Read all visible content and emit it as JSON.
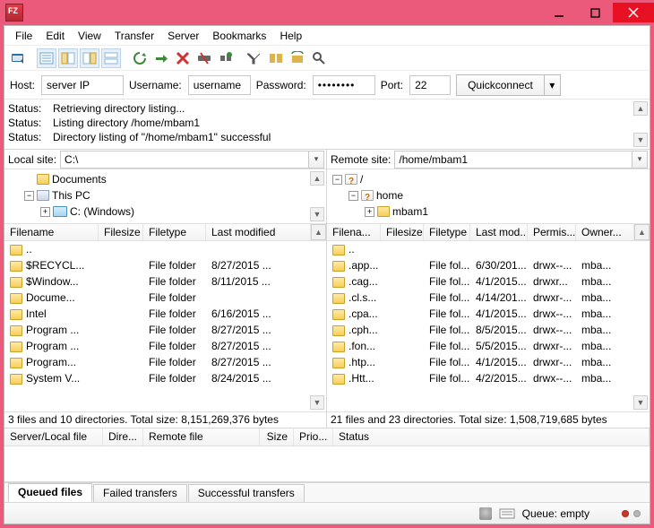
{
  "menubar": [
    "File",
    "Edit",
    "View",
    "Transfer",
    "Server",
    "Bookmarks",
    "Help"
  ],
  "connect": {
    "host_label": "Host:",
    "host_value": "server IP",
    "user_label": "Username:",
    "user_value": "username",
    "pass_label": "Password:",
    "pass_value": "••••••••",
    "port_label": "Port:",
    "port_value": "22",
    "quickconnect": "Quickconnect"
  },
  "log": {
    "status_label": "Status:",
    "lines": [
      "Retrieving directory listing...",
      "Listing directory /home/mbam1",
      "Directory listing of \"/home/mbam1\" successful"
    ]
  },
  "local": {
    "site_label": "Local site:",
    "site_value": "C:\\",
    "tree": {
      "documents": "Documents",
      "thispc": "This PC",
      "cdrive": "C: (Windows)"
    },
    "headers": [
      "Filename",
      "Filesize",
      "Filetype",
      "Last modified"
    ],
    "rows": [
      {
        "name": "..",
        "type": "",
        "mod": ""
      },
      {
        "name": "$RECYCL...",
        "type": "File folder",
        "mod": "8/27/2015 ..."
      },
      {
        "name": "$Window...",
        "type": "File folder",
        "mod": "8/11/2015 ..."
      },
      {
        "name": "Docume...",
        "type": "File folder",
        "mod": ""
      },
      {
        "name": "Intel",
        "type": "File folder",
        "mod": "6/16/2015 ..."
      },
      {
        "name": "Program ...",
        "type": "File folder",
        "mod": "8/27/2015 ..."
      },
      {
        "name": "Program ...",
        "type": "File folder",
        "mod": "8/27/2015 ..."
      },
      {
        "name": "Program...",
        "type": "File folder",
        "mod": "8/27/2015 ..."
      },
      {
        "name": "System V...",
        "type": "File folder",
        "mod": "8/24/2015 ..."
      }
    ],
    "status": "3 files and 10 directories. Total size: 8,151,269,376 bytes"
  },
  "remote": {
    "site_label": "Remote site:",
    "site_value": "/home/mbam1",
    "tree": {
      "root": "/",
      "home": "home",
      "mbam1": "mbam1"
    },
    "headers": [
      "Filena...",
      "Filesize",
      "Filetype",
      "Last mod...",
      "Permis...",
      "Owner..."
    ],
    "rows": [
      {
        "name": "..",
        "type": "",
        "mod": "",
        "perm": "",
        "owner": ""
      },
      {
        "name": ".app...",
        "type": "File fol...",
        "mod": "6/30/201...",
        "perm": "drwx--...",
        "owner": "mba..."
      },
      {
        "name": ".cag...",
        "type": "File fol...",
        "mod": "4/1/2015...",
        "perm": "drwxr...",
        "owner": "mba..."
      },
      {
        "name": ".cl.s...",
        "type": "File fol...",
        "mod": "4/14/201...",
        "perm": "drwxr-...",
        "owner": "mba..."
      },
      {
        "name": ".cpa...",
        "type": "File fol...",
        "mod": "4/1/2015...",
        "perm": "drwx--...",
        "owner": "mba..."
      },
      {
        "name": ".cph...",
        "type": "File fol...",
        "mod": "8/5/2015...",
        "perm": "drwx--...",
        "owner": "mba..."
      },
      {
        "name": ".fon...",
        "type": "File fol...",
        "mod": "5/5/2015...",
        "perm": "drwxr-...",
        "owner": "mba..."
      },
      {
        "name": ".htp...",
        "type": "File fol...",
        "mod": "4/1/2015...",
        "perm": "drwxr-...",
        "owner": "mba..."
      },
      {
        "name": ".Htt...",
        "type": "File fol...",
        "mod": "4/2/2015...",
        "perm": "drwx--...",
        "owner": "mba..."
      }
    ],
    "status": "21 files and 23 directories. Total size: 1,508,719,685 bytes"
  },
  "queue": {
    "headers": [
      "Server/Local file",
      "Dire...",
      "Remote file",
      "Size",
      "Prio...",
      "Status"
    ]
  },
  "tabs": [
    "Queued files",
    "Failed transfers",
    "Successful transfers"
  ],
  "statusbar": {
    "queue": "Queue: empty"
  }
}
